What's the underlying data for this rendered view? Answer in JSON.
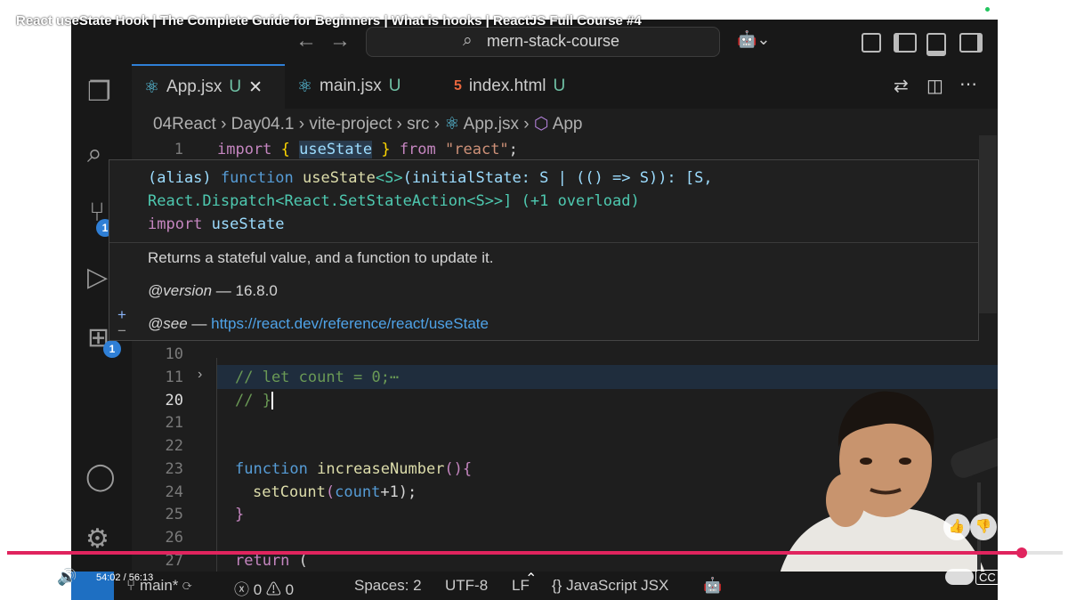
{
  "video": {
    "title": "React useState Hook | The Complete Guide for Beginners | What is hooks | ReactJS Full Course #4",
    "time": "54:02 / 56:13",
    "progress_fraction": 0.961
  },
  "vscode": {
    "search_text": "mern-stack-course",
    "tabs": [
      {
        "name": "App.jsx",
        "status": "U",
        "icon": "react-icon",
        "active": true
      },
      {
        "name": "main.jsx",
        "status": "U",
        "icon": "react-icon",
        "active": false
      },
      {
        "name": "index.html",
        "status": "U",
        "icon": "html5-icon",
        "active": false
      }
    ],
    "breadcrumb": [
      "04React",
      "Day04.1",
      "vite-project",
      "src",
      "App.jsx",
      "App"
    ],
    "activity_badges": {
      "source_control": "1",
      "extensions": "1"
    },
    "line1": {
      "number": "1",
      "kw_import": "import",
      "open": "{",
      "name": "useState",
      "close": "}",
      "kw_from": "from",
      "module": "\"react\"",
      "semi": ";"
    },
    "hover": {
      "sig_line1": {
        "alias": "(alias) ",
        "function_kw": "function ",
        "name": "useState",
        "generic": "<S>",
        "params": "(initialState: S | (() => S)): [S,"
      },
      "sig_line2": "React.Dispatch<React.SetStateAction<S>>] (+1 overload)",
      "sig_line3": {
        "import_kw": "import ",
        "name": "useState"
      },
      "description": "Returns a stateful value, and a function to update it.",
      "version_tag": "@version",
      "version_text": " — 16.8.0",
      "see_tag": "@see",
      "see_dash": " — ",
      "see_link": "https://react.dev/reference/react/useState"
    },
    "lines": [
      {
        "n": "10",
        "text": ""
      },
      {
        "n": "11",
        "text": "// let count = 0;⋯"
      },
      {
        "n": "20",
        "text": "// }"
      },
      {
        "n": "21",
        "text": ""
      },
      {
        "n": "22",
        "text": ""
      },
      {
        "n": "23",
        "kw": "function ",
        "fn": "increaseNumber",
        "rest": "(){"
      },
      {
        "n": "24",
        "fn": "setCount",
        "open": "(",
        "var": "count",
        "rest": "+1);"
      },
      {
        "n": "25",
        "text": "}"
      },
      {
        "n": "26",
        "text": ""
      },
      {
        "n": "27",
        "kw": "return",
        "rest": " ("
      }
    ],
    "status": {
      "branch": "main*",
      "errors": "0",
      "warnings": "0",
      "spaces": "Spaces: 2",
      "encoding": "UTF-8",
      "eol": "LF",
      "language": "JavaScript JSX"
    }
  },
  "colors": {
    "accent": "#2f7fd6",
    "progress": "#e0245e",
    "editor_bg": "#1e1e1e"
  }
}
